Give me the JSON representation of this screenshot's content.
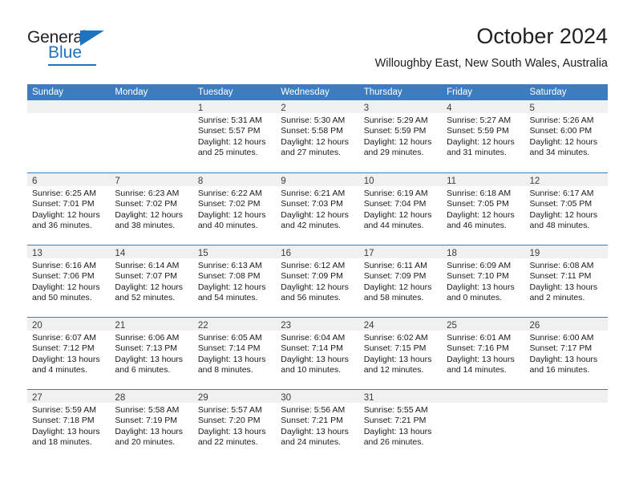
{
  "logo": {
    "word_top": "General",
    "word_bottom": "Blue",
    "triangle_icon": "triangle-icon",
    "accent_color": "#1e73be"
  },
  "header": {
    "title": "October 2024",
    "subtitle": "Willoughby East, New South Wales, Australia"
  },
  "calendar": {
    "header_color": "#3d7dbf",
    "weekdays": [
      "Sunday",
      "Monday",
      "Tuesday",
      "Wednesday",
      "Thursday",
      "Friday",
      "Saturday"
    ],
    "weeks": [
      [
        {
          "day": "",
          "lines": []
        },
        {
          "day": "",
          "lines": []
        },
        {
          "day": "1",
          "lines": [
            "Sunrise: 5:31 AM",
            "Sunset: 5:57 PM",
            "Daylight: 12 hours",
            "and 25 minutes."
          ]
        },
        {
          "day": "2",
          "lines": [
            "Sunrise: 5:30 AM",
            "Sunset: 5:58 PM",
            "Daylight: 12 hours",
            "and 27 minutes."
          ]
        },
        {
          "day": "3",
          "lines": [
            "Sunrise: 5:29 AM",
            "Sunset: 5:59 PM",
            "Daylight: 12 hours",
            "and 29 minutes."
          ]
        },
        {
          "day": "4",
          "lines": [
            "Sunrise: 5:27 AM",
            "Sunset: 5:59 PM",
            "Daylight: 12 hours",
            "and 31 minutes."
          ]
        },
        {
          "day": "5",
          "lines": [
            "Sunrise: 5:26 AM",
            "Sunset: 6:00 PM",
            "Daylight: 12 hours",
            "and 34 minutes."
          ]
        }
      ],
      [
        {
          "day": "6",
          "lines": [
            "Sunrise: 6:25 AM",
            "Sunset: 7:01 PM",
            "Daylight: 12 hours",
            "and 36 minutes."
          ]
        },
        {
          "day": "7",
          "lines": [
            "Sunrise: 6:23 AM",
            "Sunset: 7:02 PM",
            "Daylight: 12 hours",
            "and 38 minutes."
          ]
        },
        {
          "day": "8",
          "lines": [
            "Sunrise: 6:22 AM",
            "Sunset: 7:02 PM",
            "Daylight: 12 hours",
            "and 40 minutes."
          ]
        },
        {
          "day": "9",
          "lines": [
            "Sunrise: 6:21 AM",
            "Sunset: 7:03 PM",
            "Daylight: 12 hours",
            "and 42 minutes."
          ]
        },
        {
          "day": "10",
          "lines": [
            "Sunrise: 6:19 AM",
            "Sunset: 7:04 PM",
            "Daylight: 12 hours",
            "and 44 minutes."
          ]
        },
        {
          "day": "11",
          "lines": [
            "Sunrise: 6:18 AM",
            "Sunset: 7:05 PM",
            "Daylight: 12 hours",
            "and 46 minutes."
          ]
        },
        {
          "day": "12",
          "lines": [
            "Sunrise: 6:17 AM",
            "Sunset: 7:05 PM",
            "Daylight: 12 hours",
            "and 48 minutes."
          ]
        }
      ],
      [
        {
          "day": "13",
          "lines": [
            "Sunrise: 6:16 AM",
            "Sunset: 7:06 PM",
            "Daylight: 12 hours",
            "and 50 minutes."
          ]
        },
        {
          "day": "14",
          "lines": [
            "Sunrise: 6:14 AM",
            "Sunset: 7:07 PM",
            "Daylight: 12 hours",
            "and 52 minutes."
          ]
        },
        {
          "day": "15",
          "lines": [
            "Sunrise: 6:13 AM",
            "Sunset: 7:08 PM",
            "Daylight: 12 hours",
            "and 54 minutes."
          ]
        },
        {
          "day": "16",
          "lines": [
            "Sunrise: 6:12 AM",
            "Sunset: 7:09 PM",
            "Daylight: 12 hours",
            "and 56 minutes."
          ]
        },
        {
          "day": "17",
          "lines": [
            "Sunrise: 6:11 AM",
            "Sunset: 7:09 PM",
            "Daylight: 12 hours",
            "and 58 minutes."
          ]
        },
        {
          "day": "18",
          "lines": [
            "Sunrise: 6:09 AM",
            "Sunset: 7:10 PM",
            "Daylight: 13 hours",
            "and 0 minutes."
          ]
        },
        {
          "day": "19",
          "lines": [
            "Sunrise: 6:08 AM",
            "Sunset: 7:11 PM",
            "Daylight: 13 hours",
            "and 2 minutes."
          ]
        }
      ],
      [
        {
          "day": "20",
          "lines": [
            "Sunrise: 6:07 AM",
            "Sunset: 7:12 PM",
            "Daylight: 13 hours",
            "and 4 minutes."
          ]
        },
        {
          "day": "21",
          "lines": [
            "Sunrise: 6:06 AM",
            "Sunset: 7:13 PM",
            "Daylight: 13 hours",
            "and 6 minutes."
          ]
        },
        {
          "day": "22",
          "lines": [
            "Sunrise: 6:05 AM",
            "Sunset: 7:14 PM",
            "Daylight: 13 hours",
            "and 8 minutes."
          ]
        },
        {
          "day": "23",
          "lines": [
            "Sunrise: 6:04 AM",
            "Sunset: 7:14 PM",
            "Daylight: 13 hours",
            "and 10 minutes."
          ]
        },
        {
          "day": "24",
          "lines": [
            "Sunrise: 6:02 AM",
            "Sunset: 7:15 PM",
            "Daylight: 13 hours",
            "and 12 minutes."
          ]
        },
        {
          "day": "25",
          "lines": [
            "Sunrise: 6:01 AM",
            "Sunset: 7:16 PM",
            "Daylight: 13 hours",
            "and 14 minutes."
          ]
        },
        {
          "day": "26",
          "lines": [
            "Sunrise: 6:00 AM",
            "Sunset: 7:17 PM",
            "Daylight: 13 hours",
            "and 16 minutes."
          ]
        }
      ],
      [
        {
          "day": "27",
          "lines": [
            "Sunrise: 5:59 AM",
            "Sunset: 7:18 PM",
            "Daylight: 13 hours",
            "and 18 minutes."
          ]
        },
        {
          "day": "28",
          "lines": [
            "Sunrise: 5:58 AM",
            "Sunset: 7:19 PM",
            "Daylight: 13 hours",
            "and 20 minutes."
          ]
        },
        {
          "day": "29",
          "lines": [
            "Sunrise: 5:57 AM",
            "Sunset: 7:20 PM",
            "Daylight: 13 hours",
            "and 22 minutes."
          ]
        },
        {
          "day": "30",
          "lines": [
            "Sunrise: 5:56 AM",
            "Sunset: 7:21 PM",
            "Daylight: 13 hours",
            "and 24 minutes."
          ]
        },
        {
          "day": "31",
          "lines": [
            "Sunrise: 5:55 AM",
            "Sunset: 7:21 PM",
            "Daylight: 13 hours",
            "and 26 minutes."
          ]
        },
        {
          "day": "",
          "lines": []
        },
        {
          "day": "",
          "lines": []
        }
      ]
    ]
  }
}
